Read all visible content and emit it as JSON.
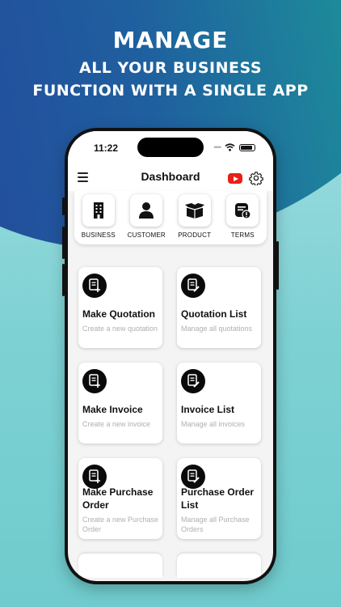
{
  "headline": {
    "line1": "MANAGE",
    "line2": "ALL YOUR BUSINESS",
    "line3": "FUNCTION  WITH A SINGLE APP"
  },
  "status_bar": {
    "time": "11:22"
  },
  "app": {
    "title": "Dashboard"
  },
  "quick_actions": [
    {
      "label": "BUSINESS",
      "icon": "building-icon"
    },
    {
      "label": "CUSTOMER",
      "icon": "person-icon"
    },
    {
      "label": "PRODUCT",
      "icon": "box-icon"
    },
    {
      "label": "TERMS",
      "icon": "terms-icon"
    }
  ],
  "cards": [
    {
      "title": "Make Quotation",
      "subtitle": "Create a new quotation",
      "icon": "doc-add-icon"
    },
    {
      "title": "Quotation List",
      "subtitle": "Manage all quotations",
      "icon": "doc-edit-icon"
    },
    {
      "title": "Make Invoice",
      "subtitle": "Create a new invoice",
      "icon": "doc-add-icon"
    },
    {
      "title": "Invoice List",
      "subtitle": "Manage all invoices",
      "icon": "doc-edit-icon"
    },
    {
      "title": "Make Purchase Order",
      "subtitle": "Create a new Purchase Order",
      "icon": "doc-add-icon"
    },
    {
      "title": "Purchase Order List",
      "subtitle": "Manage all Purchase Orders",
      "icon": "doc-edit-icon"
    }
  ],
  "colors": {
    "accent": "#0a0a0a",
    "youtube": "#e62117",
    "bg_blue": "#24479b",
    "bg_teal": "#7fd2d3"
  }
}
